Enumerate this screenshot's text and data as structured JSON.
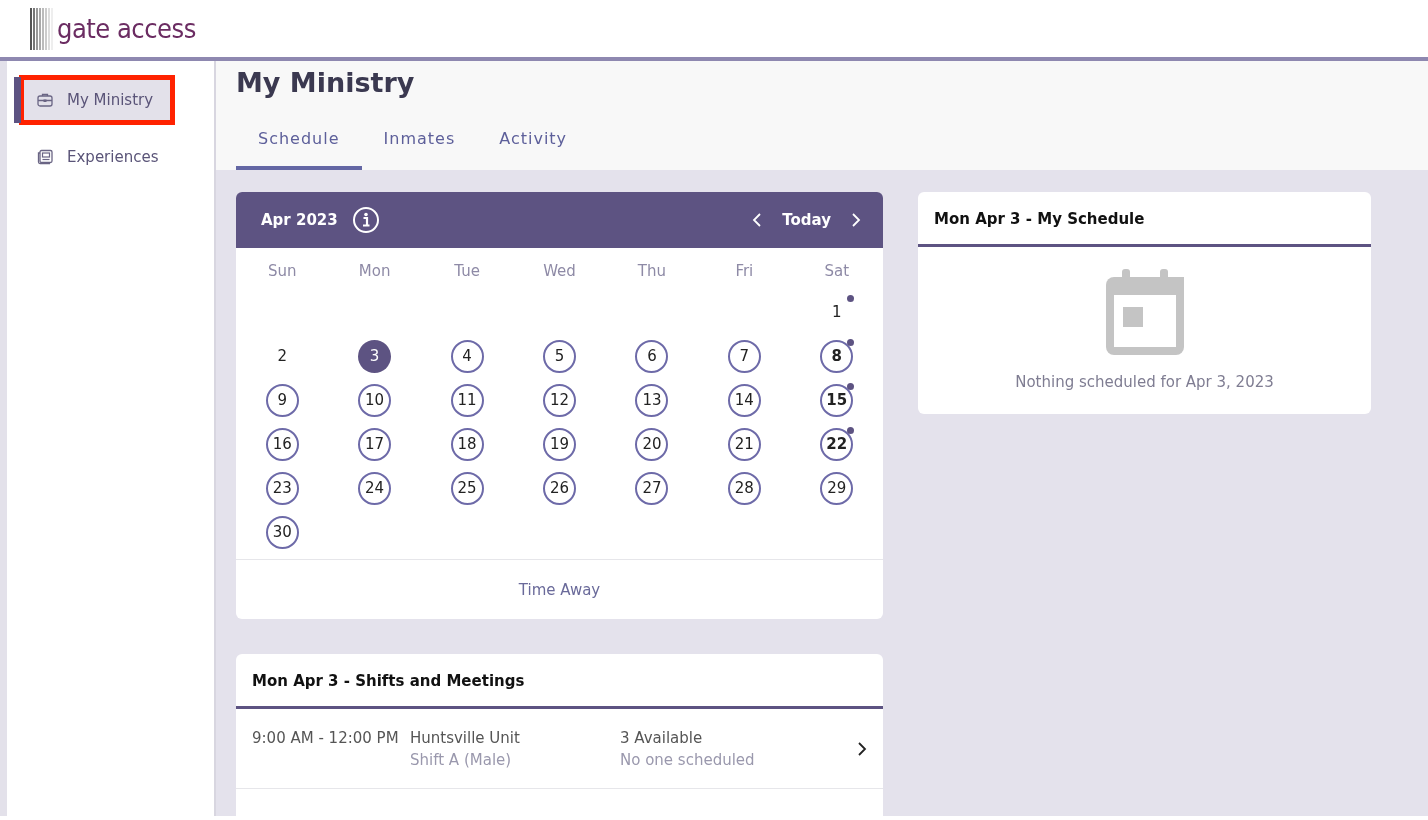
{
  "logo": {
    "text": "gate access"
  },
  "sidebar": {
    "items": [
      {
        "label": "My Ministry",
        "selected": true,
        "highlighted": true
      },
      {
        "label": "Experiences",
        "selected": false,
        "highlighted": false
      }
    ]
  },
  "page_title": "My Ministry",
  "tabs": [
    {
      "label": "Schedule",
      "selected": true
    },
    {
      "label": "Inmates",
      "selected": false
    },
    {
      "label": "Activity",
      "selected": false
    }
  ],
  "calendar": {
    "month": "Apr 2023",
    "today_button": "Today",
    "weekdays": [
      "Sun",
      "Mon",
      "Tue",
      "Wed",
      "Thu",
      "Fri",
      "Sat"
    ],
    "days": [
      {
        "label": "1",
        "selected": false,
        "outlined": false,
        "dot": true
      },
      {
        "label": "2",
        "selected": false,
        "outlined": false,
        "dot": false
      },
      {
        "label": "3",
        "selected": true,
        "outlined": false,
        "dot": false
      },
      {
        "label": "4",
        "selected": false,
        "outlined": true,
        "dot": false
      },
      {
        "label": "5",
        "selected": false,
        "outlined": true,
        "dot": false
      },
      {
        "label": "6",
        "selected": false,
        "outlined": true,
        "dot": false
      },
      {
        "label": "7",
        "selected": false,
        "outlined": true,
        "dot": false
      },
      {
        "label": "8",
        "selected": false,
        "outlined": true,
        "dot": true
      },
      {
        "label": "9",
        "selected": false,
        "outlined": true,
        "dot": false
      },
      {
        "label": "10",
        "selected": false,
        "outlined": true,
        "dot": false
      },
      {
        "label": "11",
        "selected": false,
        "outlined": true,
        "dot": false
      },
      {
        "label": "12",
        "selected": false,
        "outlined": true,
        "dot": false
      },
      {
        "label": "13",
        "selected": false,
        "outlined": true,
        "dot": false
      },
      {
        "label": "14",
        "selected": false,
        "outlined": true,
        "dot": false
      },
      {
        "label": "15",
        "selected": false,
        "outlined": true,
        "dot": true
      },
      {
        "label": "16",
        "selected": false,
        "outlined": true,
        "dot": false
      },
      {
        "label": "17",
        "selected": false,
        "outlined": true,
        "dot": false
      },
      {
        "label": "18",
        "selected": false,
        "outlined": true,
        "dot": false
      },
      {
        "label": "19",
        "selected": false,
        "outlined": true,
        "dot": false
      },
      {
        "label": "20",
        "selected": false,
        "outlined": true,
        "dot": false
      },
      {
        "label": "21",
        "selected": false,
        "outlined": true,
        "dot": false
      },
      {
        "label": "22",
        "selected": false,
        "outlined": true,
        "dot": true
      },
      {
        "label": "23",
        "selected": false,
        "outlined": true,
        "dot": false
      },
      {
        "label": "24",
        "selected": false,
        "outlined": true,
        "dot": false
      },
      {
        "label": "25",
        "selected": false,
        "outlined": true,
        "dot": false
      },
      {
        "label": "26",
        "selected": false,
        "outlined": true,
        "dot": false
      },
      {
        "label": "27",
        "selected": false,
        "outlined": true,
        "dot": false
      },
      {
        "label": "28",
        "selected": false,
        "outlined": true,
        "dot": false
      },
      {
        "label": "29",
        "selected": false,
        "outlined": true,
        "dot": false
      },
      {
        "label": "30",
        "selected": false,
        "outlined": true,
        "dot": false
      }
    ],
    "footer_link": "Time Away"
  },
  "shifts": {
    "title": "Mon Apr 3 - Shifts and Meetings",
    "rows": [
      {
        "time": "9:00 AM - 12:00 PM",
        "location": "Huntsville Unit",
        "shift": "Shift A (Male)",
        "availability": "3 Available",
        "scheduled": "No one scheduled"
      }
    ]
  },
  "my_schedule": {
    "title": "Mon Apr 3 - My Schedule",
    "empty_message": "Nothing scheduled for Apr 3, 2023"
  }
}
